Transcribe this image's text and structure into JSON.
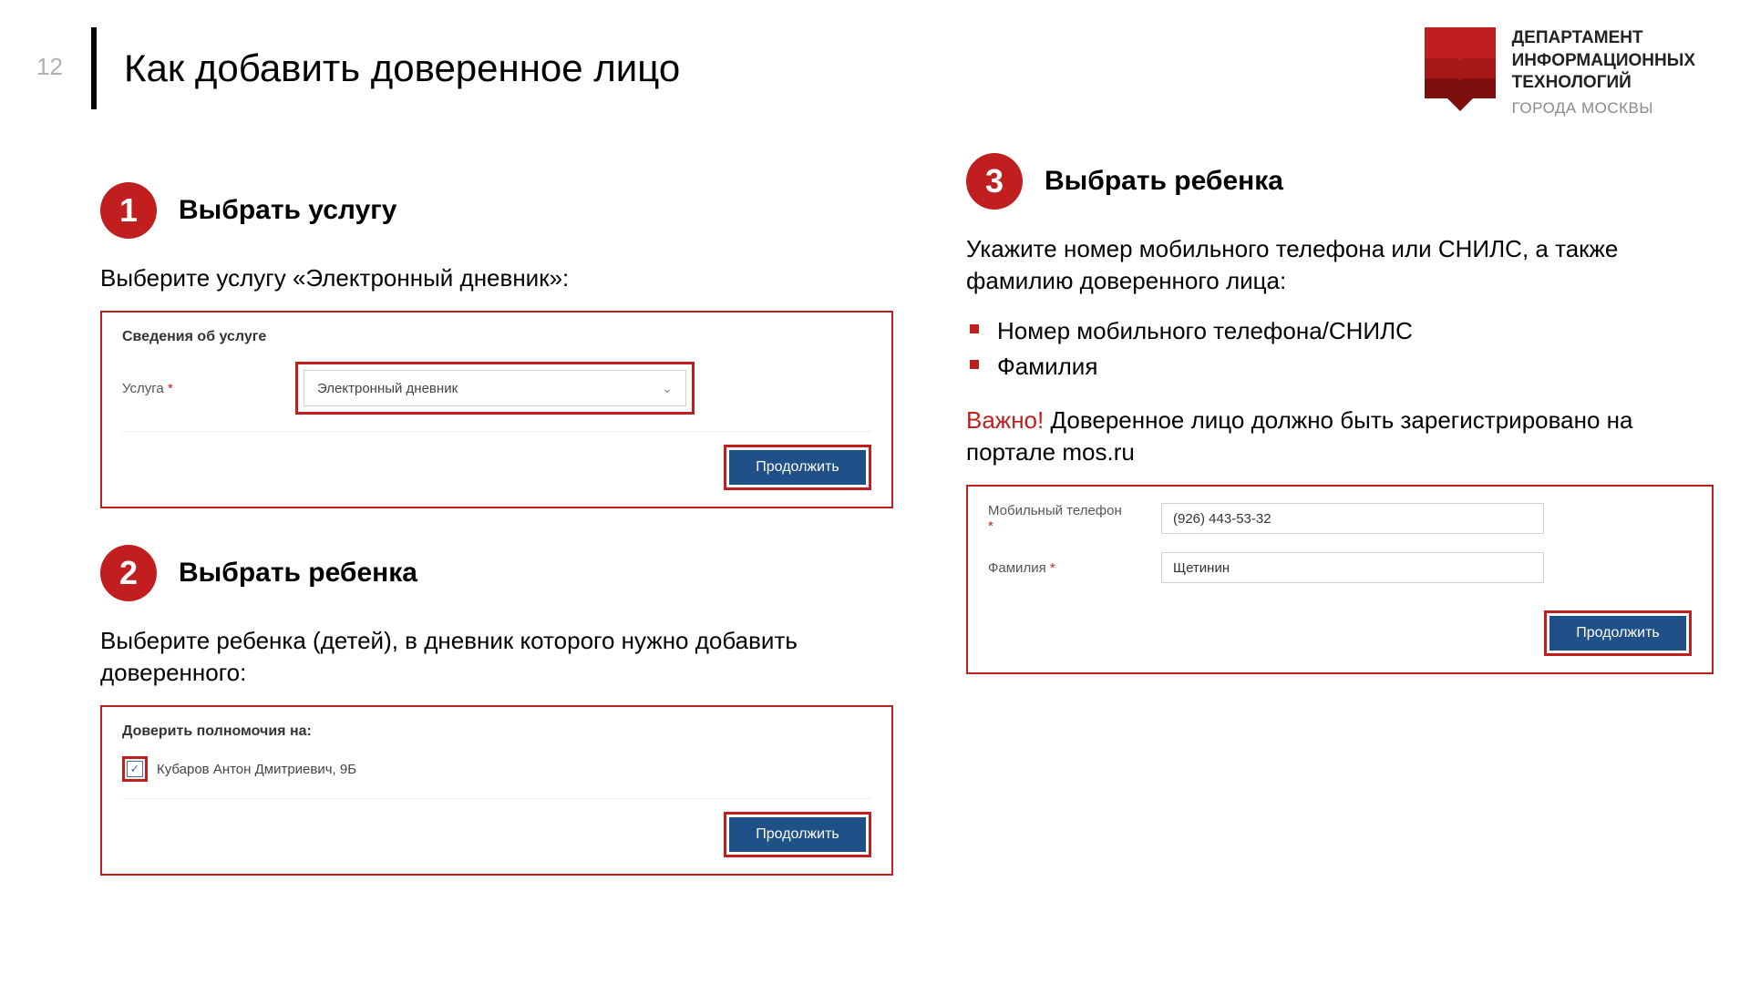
{
  "page_number": "12",
  "title": "Как добавить доверенное лицо",
  "branding": {
    "line1": "ДЕПАРТАМЕНТ",
    "line2": "ИНФОРМАЦИОННЫХ",
    "line3": "ТЕХНОЛОГИЙ",
    "line4": "ГОРОДА МОСКВЫ"
  },
  "step1": {
    "num": "1",
    "title": "Выбрать услугу",
    "desc": "Выберите услугу «Электронный дневник»:",
    "panel_heading": "Сведения об услуге",
    "field_label": "Услуга",
    "dropdown_value": "Электронный дневник",
    "continue": "Продолжить"
  },
  "step2": {
    "num": "2",
    "title": "Выбрать ребенка",
    "desc": "Выберите ребенка (детей), в дневник которого нужно добавить доверенного:",
    "panel_heading": "Доверить полномочия на:",
    "child_name": "Кубаров Антон Дмитриевич, 9Б",
    "continue": "Продолжить"
  },
  "step3": {
    "num": "3",
    "title": "Выбрать ребенка",
    "desc_intro": "Укажите номер мобильного телефона или СНИЛС, а также фамилию доверенного лица:",
    "bullets": [
      "Номер мобильного телефона/СНИЛС",
      "Фамилия"
    ],
    "important_label": "Важно!",
    "important_text": " Доверенное лицо должно быть зарегистрировано на портале mos.ru",
    "phone_label": "Мобильный телефон",
    "phone_value": "(926) 443-53-32",
    "lastname_label": "Фамилия",
    "lastname_value": "Щетинин",
    "continue": "Продолжить"
  }
}
